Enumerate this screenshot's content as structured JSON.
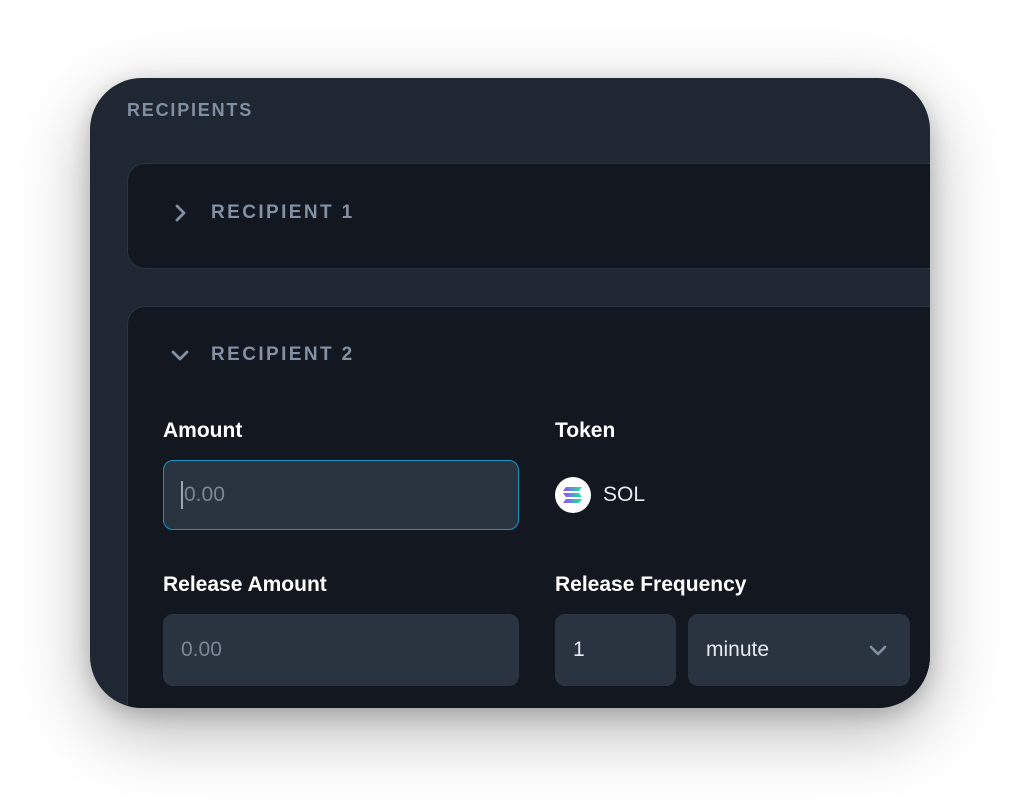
{
  "section": {
    "title": "RECIPIENTS"
  },
  "recipients": [
    {
      "title": "RECIPIENT 1",
      "state": "collapsed"
    },
    {
      "title": "RECIPIENT 2",
      "state": "expanded",
      "amount": {
        "label": "Amount",
        "placeholder": "0.00"
      },
      "token": {
        "label": "Token",
        "symbol": "SOL",
        "icon": "solana-icon"
      },
      "release_amount": {
        "label": "Release Amount",
        "placeholder": "0.00"
      },
      "release_frequency": {
        "label": "Release Frequency",
        "value": "1",
        "unit": "minute"
      }
    }
  ],
  "colors": {
    "background": "#1f2732",
    "card": "#121720",
    "input": "#2a3441",
    "focus_border": "#1593c7",
    "muted_text": "#8391a4"
  }
}
